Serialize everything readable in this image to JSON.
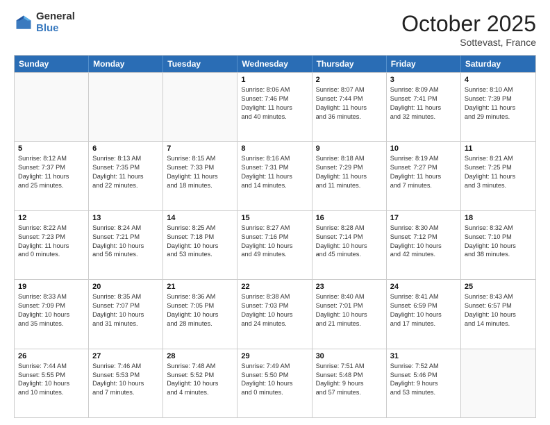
{
  "logo": {
    "general": "General",
    "blue": "Blue"
  },
  "header": {
    "month": "October 2025",
    "location": "Sottevast, France"
  },
  "days": [
    "Sunday",
    "Monday",
    "Tuesday",
    "Wednesday",
    "Thursday",
    "Friday",
    "Saturday"
  ],
  "rows": [
    [
      {
        "day": "",
        "lines": [],
        "empty": true
      },
      {
        "day": "",
        "lines": [],
        "empty": true
      },
      {
        "day": "",
        "lines": [],
        "empty": true
      },
      {
        "day": "1",
        "lines": [
          "Sunrise: 8:06 AM",
          "Sunset: 7:46 PM",
          "Daylight: 11 hours",
          "and 40 minutes."
        ]
      },
      {
        "day": "2",
        "lines": [
          "Sunrise: 8:07 AM",
          "Sunset: 7:44 PM",
          "Daylight: 11 hours",
          "and 36 minutes."
        ]
      },
      {
        "day": "3",
        "lines": [
          "Sunrise: 8:09 AM",
          "Sunset: 7:41 PM",
          "Daylight: 11 hours",
          "and 32 minutes."
        ]
      },
      {
        "day": "4",
        "lines": [
          "Sunrise: 8:10 AM",
          "Sunset: 7:39 PM",
          "Daylight: 11 hours",
          "and 29 minutes."
        ]
      }
    ],
    [
      {
        "day": "5",
        "lines": [
          "Sunrise: 8:12 AM",
          "Sunset: 7:37 PM",
          "Daylight: 11 hours",
          "and 25 minutes."
        ]
      },
      {
        "day": "6",
        "lines": [
          "Sunrise: 8:13 AM",
          "Sunset: 7:35 PM",
          "Daylight: 11 hours",
          "and 22 minutes."
        ]
      },
      {
        "day": "7",
        "lines": [
          "Sunrise: 8:15 AM",
          "Sunset: 7:33 PM",
          "Daylight: 11 hours",
          "and 18 minutes."
        ]
      },
      {
        "day": "8",
        "lines": [
          "Sunrise: 8:16 AM",
          "Sunset: 7:31 PM",
          "Daylight: 11 hours",
          "and 14 minutes."
        ]
      },
      {
        "day": "9",
        "lines": [
          "Sunrise: 8:18 AM",
          "Sunset: 7:29 PM",
          "Daylight: 11 hours",
          "and 11 minutes."
        ]
      },
      {
        "day": "10",
        "lines": [
          "Sunrise: 8:19 AM",
          "Sunset: 7:27 PM",
          "Daylight: 11 hours",
          "and 7 minutes."
        ]
      },
      {
        "day": "11",
        "lines": [
          "Sunrise: 8:21 AM",
          "Sunset: 7:25 PM",
          "Daylight: 11 hours",
          "and 3 minutes."
        ]
      }
    ],
    [
      {
        "day": "12",
        "lines": [
          "Sunrise: 8:22 AM",
          "Sunset: 7:23 PM",
          "Daylight: 11 hours",
          "and 0 minutes."
        ]
      },
      {
        "day": "13",
        "lines": [
          "Sunrise: 8:24 AM",
          "Sunset: 7:21 PM",
          "Daylight: 10 hours",
          "and 56 minutes."
        ]
      },
      {
        "day": "14",
        "lines": [
          "Sunrise: 8:25 AM",
          "Sunset: 7:18 PM",
          "Daylight: 10 hours",
          "and 53 minutes."
        ]
      },
      {
        "day": "15",
        "lines": [
          "Sunrise: 8:27 AM",
          "Sunset: 7:16 PM",
          "Daylight: 10 hours",
          "and 49 minutes."
        ]
      },
      {
        "day": "16",
        "lines": [
          "Sunrise: 8:28 AM",
          "Sunset: 7:14 PM",
          "Daylight: 10 hours",
          "and 45 minutes."
        ]
      },
      {
        "day": "17",
        "lines": [
          "Sunrise: 8:30 AM",
          "Sunset: 7:12 PM",
          "Daylight: 10 hours",
          "and 42 minutes."
        ]
      },
      {
        "day": "18",
        "lines": [
          "Sunrise: 8:32 AM",
          "Sunset: 7:10 PM",
          "Daylight: 10 hours",
          "and 38 minutes."
        ]
      }
    ],
    [
      {
        "day": "19",
        "lines": [
          "Sunrise: 8:33 AM",
          "Sunset: 7:09 PM",
          "Daylight: 10 hours",
          "and 35 minutes."
        ]
      },
      {
        "day": "20",
        "lines": [
          "Sunrise: 8:35 AM",
          "Sunset: 7:07 PM",
          "Daylight: 10 hours",
          "and 31 minutes."
        ]
      },
      {
        "day": "21",
        "lines": [
          "Sunrise: 8:36 AM",
          "Sunset: 7:05 PM",
          "Daylight: 10 hours",
          "and 28 minutes."
        ]
      },
      {
        "day": "22",
        "lines": [
          "Sunrise: 8:38 AM",
          "Sunset: 7:03 PM",
          "Daylight: 10 hours",
          "and 24 minutes."
        ]
      },
      {
        "day": "23",
        "lines": [
          "Sunrise: 8:40 AM",
          "Sunset: 7:01 PM",
          "Daylight: 10 hours",
          "and 21 minutes."
        ]
      },
      {
        "day": "24",
        "lines": [
          "Sunrise: 8:41 AM",
          "Sunset: 6:59 PM",
          "Daylight: 10 hours",
          "and 17 minutes."
        ]
      },
      {
        "day": "25",
        "lines": [
          "Sunrise: 8:43 AM",
          "Sunset: 6:57 PM",
          "Daylight: 10 hours",
          "and 14 minutes."
        ]
      }
    ],
    [
      {
        "day": "26",
        "lines": [
          "Sunrise: 7:44 AM",
          "Sunset: 5:55 PM",
          "Daylight: 10 hours",
          "and 10 minutes."
        ]
      },
      {
        "day": "27",
        "lines": [
          "Sunrise: 7:46 AM",
          "Sunset: 5:53 PM",
          "Daylight: 10 hours",
          "and 7 minutes."
        ]
      },
      {
        "day": "28",
        "lines": [
          "Sunrise: 7:48 AM",
          "Sunset: 5:52 PM",
          "Daylight: 10 hours",
          "and 4 minutes."
        ]
      },
      {
        "day": "29",
        "lines": [
          "Sunrise: 7:49 AM",
          "Sunset: 5:50 PM",
          "Daylight: 10 hours",
          "and 0 minutes."
        ]
      },
      {
        "day": "30",
        "lines": [
          "Sunrise: 7:51 AM",
          "Sunset: 5:48 PM",
          "Daylight: 9 hours",
          "and 57 minutes."
        ]
      },
      {
        "day": "31",
        "lines": [
          "Sunrise: 7:52 AM",
          "Sunset: 5:46 PM",
          "Daylight: 9 hours",
          "and 53 minutes."
        ]
      },
      {
        "day": "",
        "lines": [],
        "empty": true
      }
    ]
  ]
}
